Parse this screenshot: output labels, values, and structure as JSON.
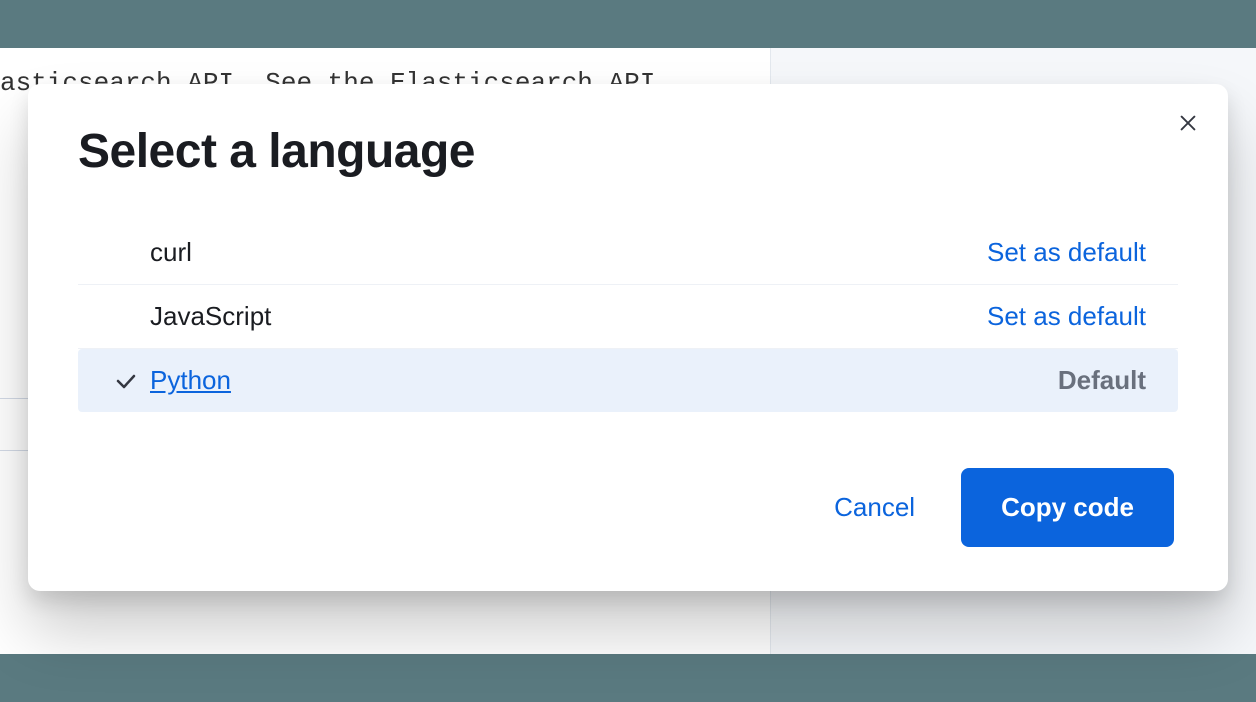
{
  "background": {
    "partial_text": "asticsearch API. See the Elasticsearch API"
  },
  "modal": {
    "title": "Select a language",
    "close_aria": "Close",
    "languages": [
      {
        "name": "curl",
        "selected": false,
        "is_default": false,
        "action_label": "Set as default"
      },
      {
        "name": "JavaScript",
        "selected": false,
        "is_default": false,
        "action_label": "Set as default"
      },
      {
        "name": "Python",
        "selected": true,
        "is_default": true,
        "action_label": "Default"
      }
    ],
    "footer": {
      "cancel": "Cancel",
      "confirm": "Copy code"
    }
  }
}
